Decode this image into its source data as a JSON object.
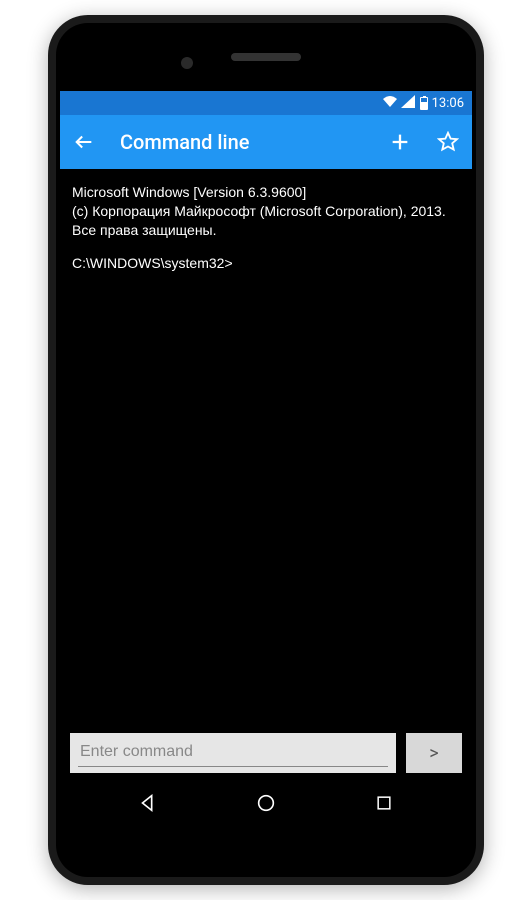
{
  "statusbar": {
    "time": "13:06"
  },
  "appbar": {
    "title": "Command line"
  },
  "terminal": {
    "line1": "Microsoft Windows [Version 6.3.9600]",
    "line2": "(c) Корпорация Майкрософт (Microsoft Corporation), 2013. Все права защищены.",
    "prompt": "C:\\WINDOWS\\system32>"
  },
  "input": {
    "placeholder": "Enter command",
    "send_label": ">"
  }
}
